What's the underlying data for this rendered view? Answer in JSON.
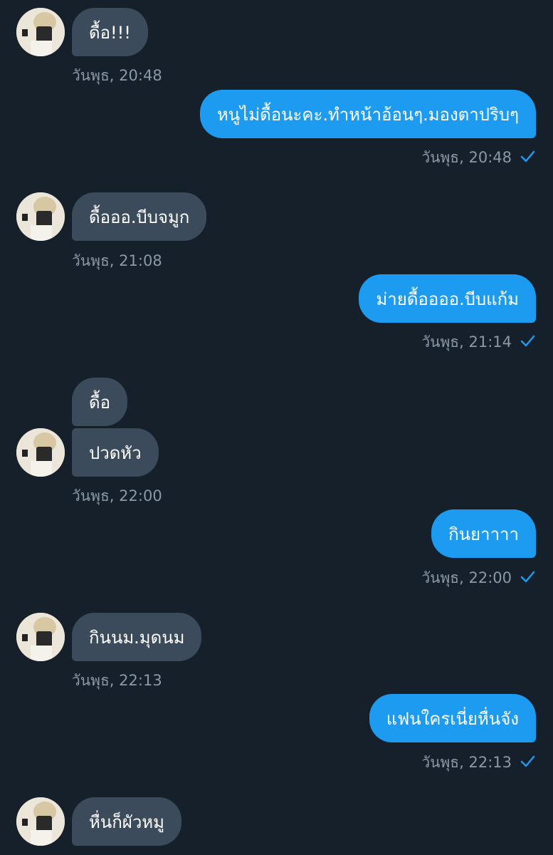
{
  "messages": [
    {
      "side": "in",
      "text": "ดื้อ!!!",
      "time": "วันพุธ, 20:48"
    },
    {
      "side": "out",
      "text": "หนูไม่ดื้อนะคะ.ทำหน้าอ้อนๆ.มองตาปริบๆ",
      "time": "วันพุธ, 20:48"
    },
    {
      "side": "in",
      "text": "ดื้อออ.บีบจมูก",
      "time": "วันพุธ, 21:08"
    },
    {
      "side": "out",
      "text": "ม่ายดื้ออออ.บีบแก้ม",
      "time": "วันพุธ, 21:14"
    },
    {
      "side": "in",
      "text": "ดื้อ"
    },
    {
      "side": "in",
      "text": "ปวดหัว",
      "time": "วันพุธ, 22:00"
    },
    {
      "side": "out",
      "text": "กินยาาาา",
      "time": "วันพุธ, 22:00"
    },
    {
      "side": "in",
      "text": "กินนม.มุดนม",
      "time": "วันพุธ, 22:13"
    },
    {
      "side": "out",
      "text": "แฟนใครเนี่ยหื่นจัง",
      "time": "วันพุธ, 22:13"
    },
    {
      "side": "in",
      "text": "หื่นก็ผัวหมู"
    }
  ],
  "colors": {
    "background": "#15202b",
    "incoming_bubble": "#3c4b5c",
    "outgoing_bubble": "#1d9bf0",
    "timestamp": "#8b98a5",
    "read_check": "#1d9bf0"
  },
  "icons": {
    "avatar": "user-avatar-photo",
    "read_receipt": "checkmark-icon"
  }
}
